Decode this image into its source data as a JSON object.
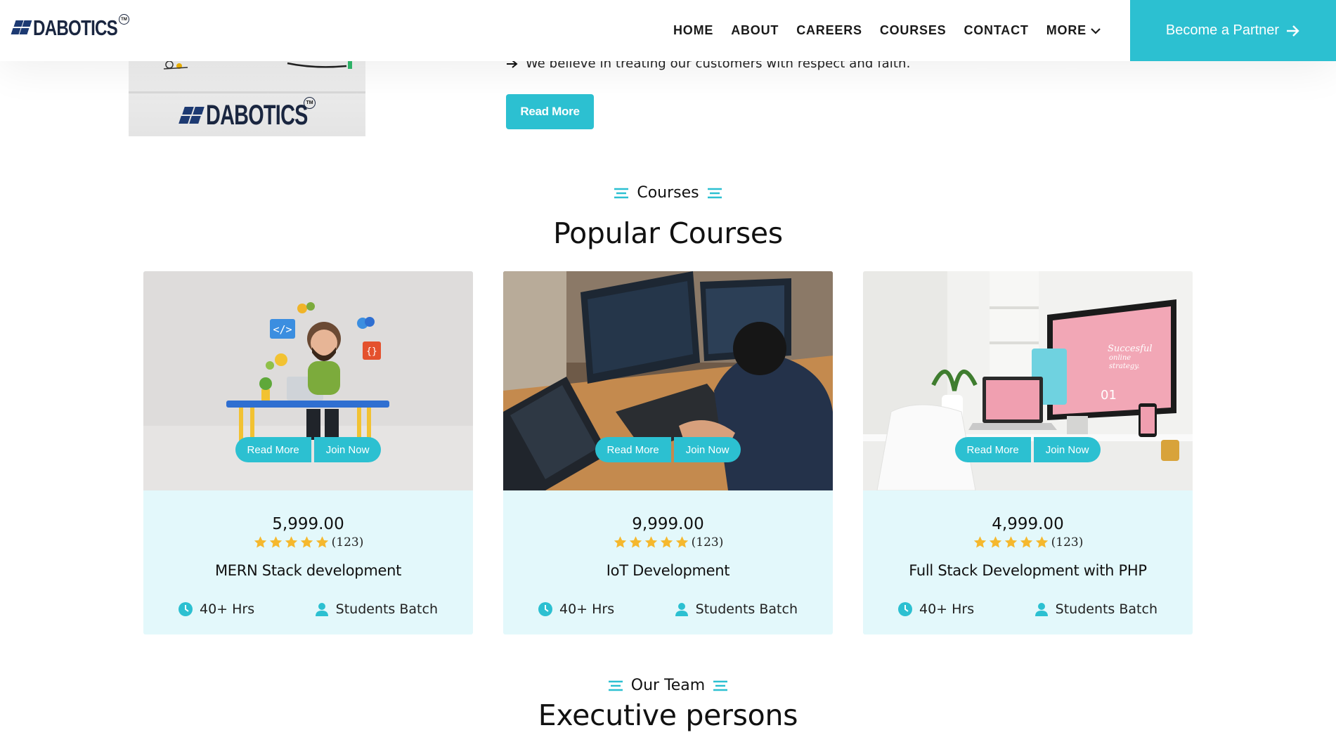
{
  "header": {
    "logo_text": "DABOTICS",
    "logo_tm": "TM",
    "nav": [
      "HOME",
      "ABOUT",
      "CAREERS",
      "COURSES",
      "CONTACT",
      "MORE"
    ],
    "partner_label": "Become a Partner"
  },
  "about": {
    "image_logo_text": "DABOTICS",
    "image_logo_tm": "TM",
    "line": "We believe in treating our customers with respect and faith.",
    "read_more": "Read More"
  },
  "courses_section": {
    "subtitle": "Courses",
    "title": "Popular Courses"
  },
  "courses": [
    {
      "price": "5,999.00",
      "rating": 5,
      "rating_count": "(123)",
      "title": "MERN Stack development",
      "hours": "40+ Hrs",
      "batch": "Students Batch",
      "read_more": "Read More",
      "join_now": "Join Now"
    },
    {
      "price": "9,999.00",
      "rating": 5,
      "rating_count": "(123)",
      "title": "IoT Development",
      "hours": "40+ Hrs",
      "batch": "Students Batch",
      "read_more": "Read More",
      "join_now": "Join Now"
    },
    {
      "price": "4,999.00",
      "rating": 5,
      "rating_count": "(123)",
      "title": "Full Stack Development with PHP",
      "hours": "40+ Hrs",
      "batch": "Students Batch",
      "read_more": "Read More",
      "join_now": "Join Now"
    }
  ],
  "team_section": {
    "subtitle": "Our Team",
    "title": "Executive persons"
  },
  "colors": {
    "accent": "#2cc0d1",
    "card_bg": "#e3f8fb",
    "star": "#f5b82e",
    "logo": "#1d3a72"
  },
  "icons": {
    "nav_more": "chevron-down-icon",
    "partner": "arrow-right-icon",
    "section": "lines-icon",
    "hours": "clock-icon",
    "batch": "user-icon",
    "rating": "star-icon"
  }
}
